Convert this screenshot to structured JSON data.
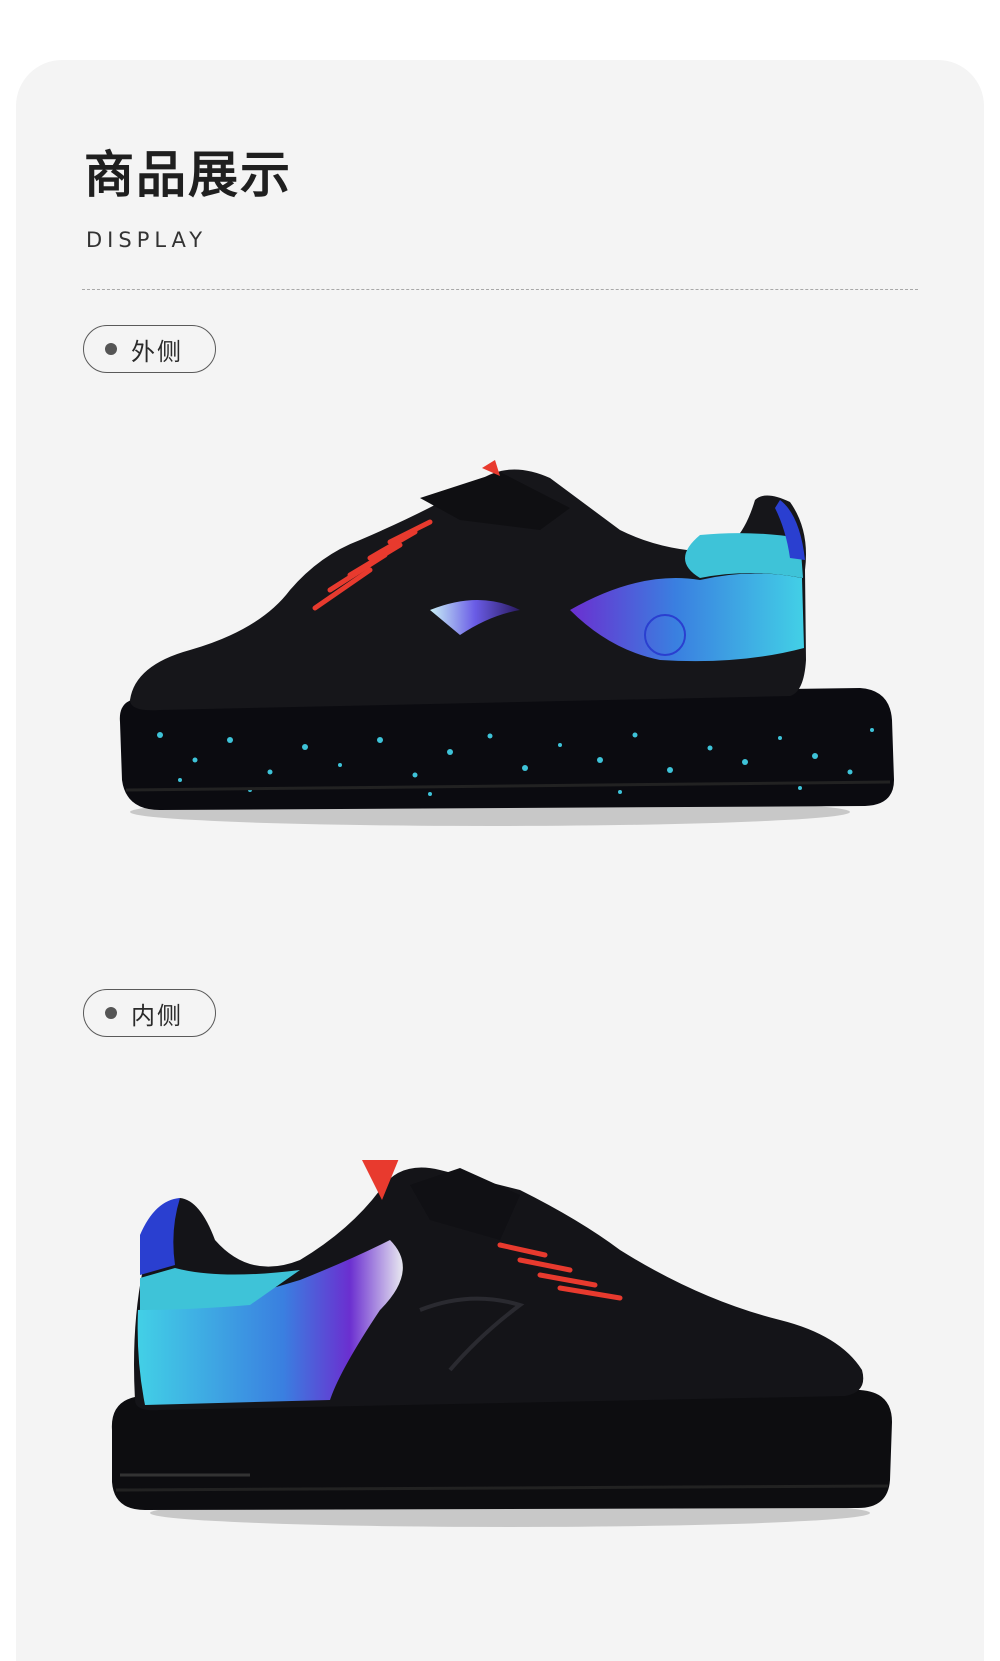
{
  "header": {
    "title": "商品展示",
    "subtitle": "DISPLAY"
  },
  "views": [
    {
      "label": "外侧"
    },
    {
      "label": "内侧"
    }
  ],
  "colors": {
    "background": "#f4f4f4",
    "shoe_black": "#121214",
    "accent_cyan": "#3ec3d8",
    "accent_blue": "#2a3fd0",
    "accent_purple": "#7a3ad0",
    "accent_red": "#e83a2e"
  }
}
